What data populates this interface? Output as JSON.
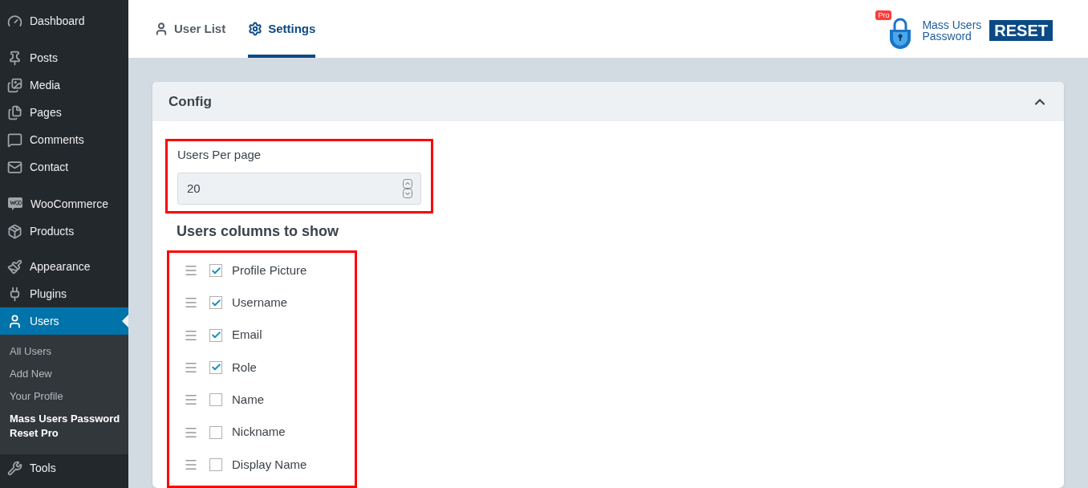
{
  "sidebar": {
    "groups": [
      [
        {
          "label": "Dashboard",
          "selected": false
        }
      ],
      [
        {
          "label": "Posts",
          "selected": false
        },
        {
          "label": "Media",
          "selected": false
        },
        {
          "label": "Pages",
          "selected": false
        },
        {
          "label": "Comments",
          "selected": false
        },
        {
          "label": "Contact",
          "selected": false
        }
      ],
      [
        {
          "label": "WooCommerce",
          "selected": false
        },
        {
          "label": "Products",
          "selected": false
        }
      ],
      [
        {
          "label": "Appearance",
          "selected": false
        },
        {
          "label": "Plugins",
          "selected": false
        },
        {
          "label": "Users",
          "selected": true,
          "children": [
            {
              "label": "All Users",
              "selected": false
            },
            {
              "label": "Add New",
              "selected": false
            },
            {
              "label": "Your Profile",
              "selected": false
            },
            {
              "label": "Mass Users Password Reset Pro",
              "selected": true
            }
          ]
        },
        {
          "label": "Tools",
          "selected": false
        }
      ]
    ]
  },
  "tabs": [
    {
      "label": "User List",
      "selected": false
    },
    {
      "label": "Settings",
      "selected": true
    }
  ],
  "logo": {
    "badge": "Pro",
    "line1": "Mass Users",
    "line2": "Password",
    "mark": "RESET"
  },
  "panel": {
    "title": "Config",
    "expanded": true,
    "per_page": {
      "label": "Users Per page",
      "value": "20"
    },
    "columns_heading": "Users columns to show",
    "columns": [
      {
        "label": "Profile Picture",
        "checked": true
      },
      {
        "label": "Username",
        "checked": true
      },
      {
        "label": "Email",
        "checked": true
      },
      {
        "label": "Role",
        "checked": true
      },
      {
        "label": "Name",
        "checked": false
      },
      {
        "label": "Nickname",
        "checked": false
      },
      {
        "label": "Display Name",
        "checked": false
      }
    ]
  }
}
